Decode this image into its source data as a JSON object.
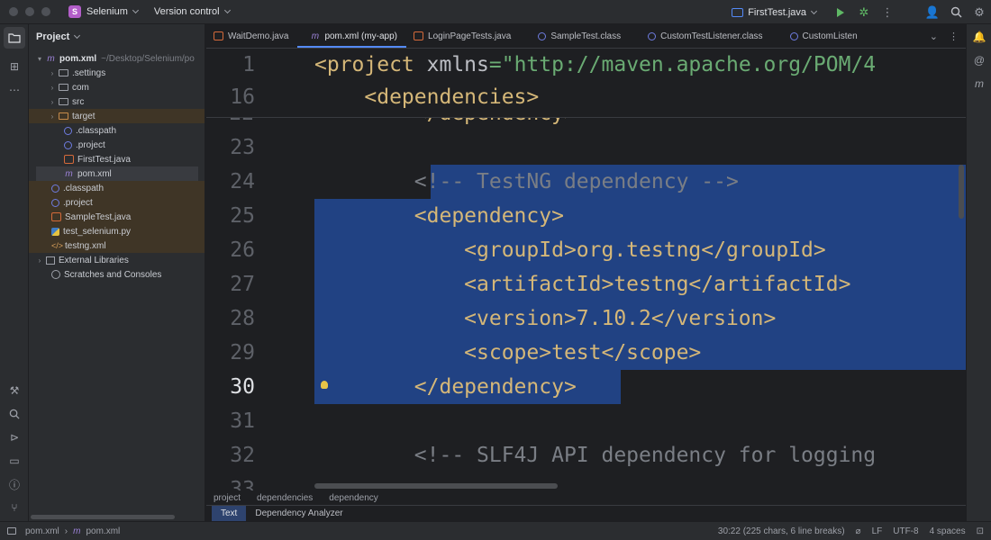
{
  "titlebar": {
    "project_badge": "S",
    "project_name": "Selenium",
    "version_control": "Version control",
    "run_config": "FirstTest.java"
  },
  "project_panel": {
    "title": "Project",
    "tree": [
      {
        "label": "pom.xml",
        "extra": "~/Desktop/Selenium/po",
        "icon": "m-icon",
        "depth": 0,
        "arrow": "down"
      },
      {
        "label": ".settings",
        "icon": "folder-icon",
        "depth": 1,
        "arrow": "right"
      },
      {
        "label": "com",
        "icon": "folder-icon",
        "depth": 1,
        "arrow": "right"
      },
      {
        "label": "src",
        "icon": "folder-icon",
        "depth": 1,
        "arrow": "right"
      },
      {
        "label": "target",
        "icon": "folder-icon",
        "depth": 1,
        "arrow": "right"
      },
      {
        "label": ".classpath",
        "icon": "dot-icon",
        "depth": 1
      },
      {
        "label": ".project",
        "icon": "dot-icon",
        "depth": 1
      },
      {
        "label": "FirstTest.java",
        "icon": "java-icon",
        "depth": 1
      },
      {
        "label": "pom.xml",
        "icon": "m-icon",
        "depth": 1
      },
      {
        "label": ".classpath",
        "icon": "dot-icon",
        "depth": 0
      },
      {
        "label": ".project",
        "icon": "dot-icon",
        "depth": 0
      },
      {
        "label": "SampleTest.java",
        "icon": "java-icon",
        "depth": 0
      },
      {
        "label": "test_selenium.py",
        "icon": "python-icon",
        "depth": 0
      },
      {
        "label": "testng.xml",
        "icon": "xml-icon",
        "depth": 0
      },
      {
        "label": "External Libraries",
        "icon": "library-icon",
        "depth": -1,
        "arrow": "right"
      },
      {
        "label": "Scratches and Consoles",
        "icon": "scratch-icon",
        "depth": -1
      }
    ]
  },
  "tabs": [
    {
      "label": "WaitDemo.java",
      "icon": "java-icon"
    },
    {
      "label": "pom.xml (my-app)",
      "icon": "m-icon",
      "active": true
    },
    {
      "label": "LoginPageTests.java",
      "icon": "java-icon"
    },
    {
      "label": "SampleTest.class",
      "icon": "class-icon"
    },
    {
      "label": "CustomTestListener.class",
      "icon": "class-icon"
    },
    {
      "label": "CustomListen",
      "icon": "class-icon"
    }
  ],
  "editor": {
    "sticky": [
      {
        "num": "1",
        "code": "<project xmlns=\"http://maven.apache.org/POM/4"
      },
      {
        "num": "16",
        "code": "    <dependencies>"
      }
    ],
    "lines": [
      {
        "num": "23",
        "code": ""
      },
      {
        "num": "24",
        "code": "        <!-- TestNG dependency -->"
      },
      {
        "num": "25",
        "code": "        <dependency>"
      },
      {
        "num": "26",
        "code": "            <groupId>org.testng</groupId>"
      },
      {
        "num": "27",
        "code": "            <artifactId>testng</artifactId>"
      },
      {
        "num": "28",
        "code": "            <version>7.10.2</version>"
      },
      {
        "num": "29",
        "code": "            <scope>test</scope>"
      },
      {
        "num": "30",
        "code": "        </dependency>"
      },
      {
        "num": "31",
        "code": ""
      },
      {
        "num": "32",
        "code": "        <!-- SLF4J API dependency for logging"
      }
    ],
    "partial_top": "        </dependency>"
  },
  "breadcrumbs": [
    "project",
    "dependencies",
    "dependency"
  ],
  "bottom_tabs": [
    "Text",
    "Dependency Analyzer"
  ],
  "status": {
    "path_project": "pom.xml",
    "path_file": "pom.xml",
    "position": "30:22 (225 chars, 6 line breaks)",
    "line_sep": "LF",
    "encoding": "UTF-8",
    "indent": "4 spaces"
  },
  "colors": {
    "accent": "#548af7",
    "selection": "#214283",
    "tag": "#d5b778",
    "string": "#6aab73",
    "comment": "#7a7e85"
  }
}
